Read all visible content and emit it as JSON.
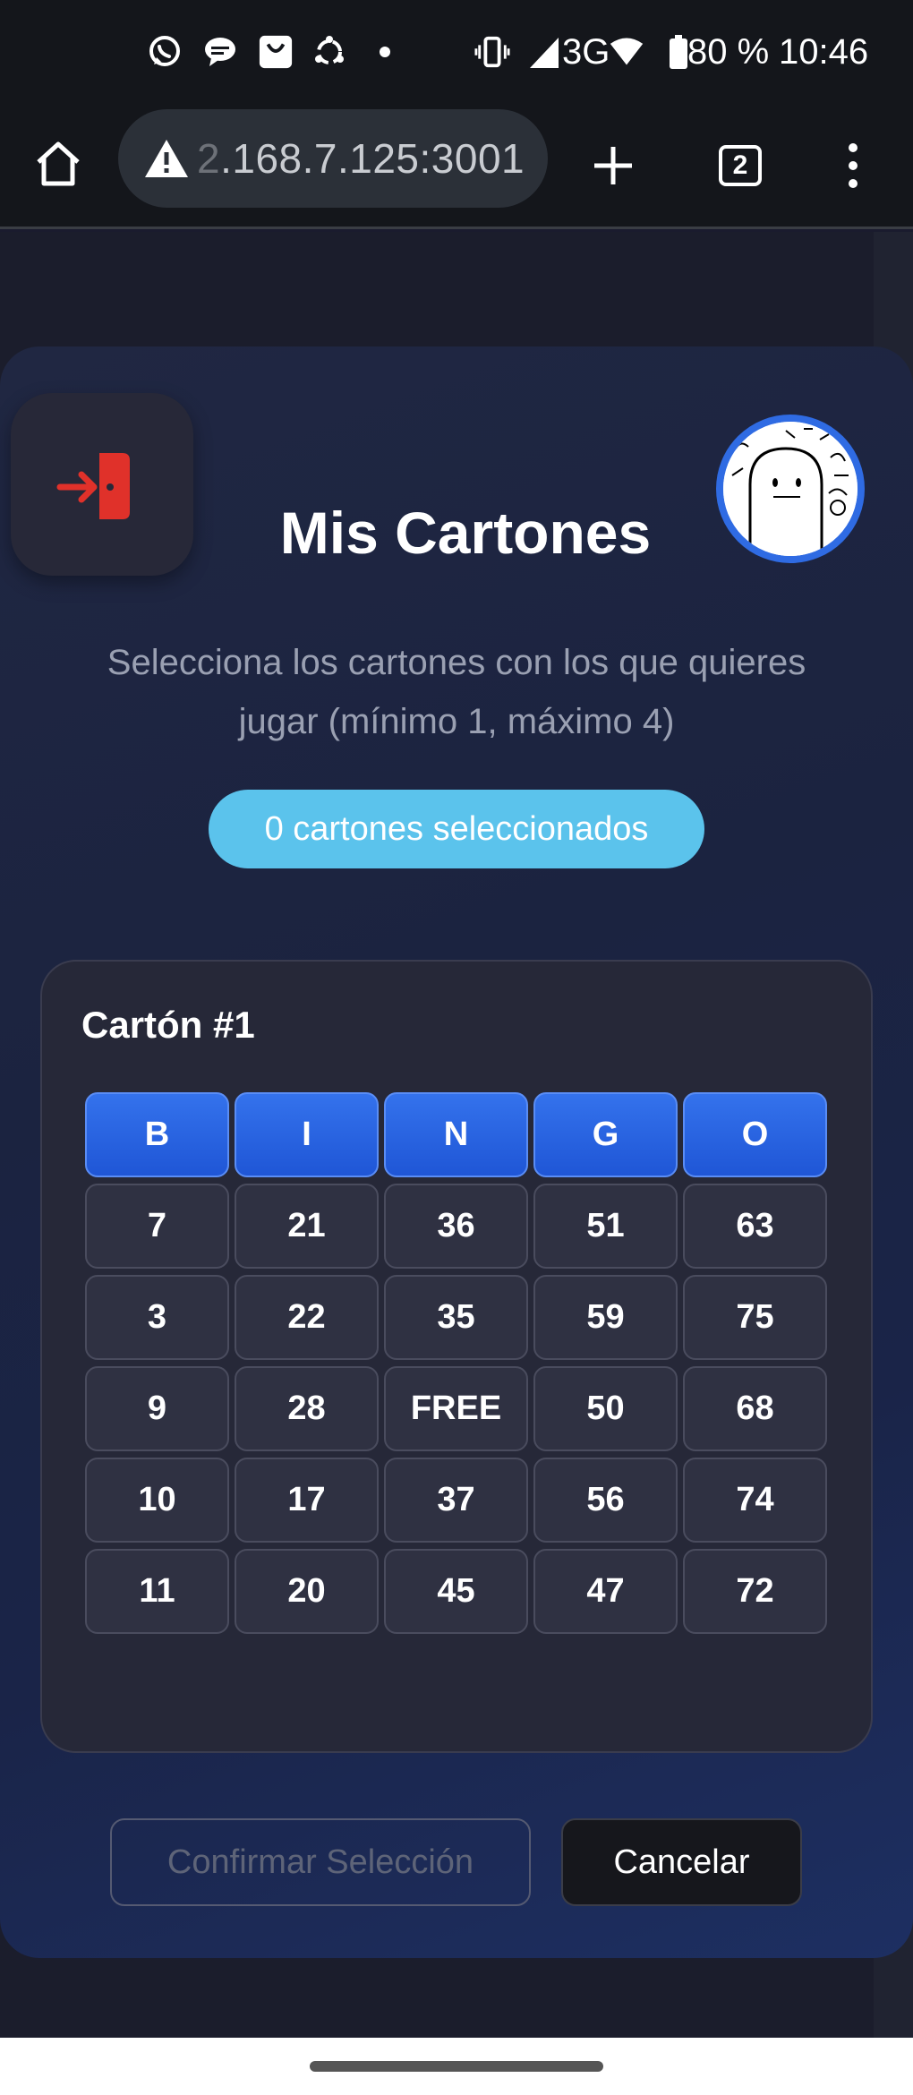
{
  "status_bar": {
    "network": "3G",
    "battery": "80 %",
    "time": "10:46"
  },
  "browser": {
    "url_faded": "2",
    "url": ".168.7.125:3001",
    "tabs_count": "2"
  },
  "modal": {
    "title": "Mis Cartones",
    "subtitle": "Selecciona los cartones con los que quieres jugar (mínimo 1, máximo 4)",
    "selected_count": "0 cartones seleccionados",
    "card": {
      "title": "Cartón #1",
      "headers": [
        "B",
        "I",
        "N",
        "G",
        "O"
      ],
      "rows": [
        [
          "7",
          "21",
          "36",
          "51",
          "63"
        ],
        [
          "3",
          "22",
          "35",
          "59",
          "75"
        ],
        [
          "9",
          "28",
          "FREE",
          "50",
          "68"
        ],
        [
          "10",
          "17",
          "37",
          "56",
          "74"
        ],
        [
          "11",
          "20",
          "45",
          "47",
          "72"
        ]
      ]
    },
    "confirm_label": "Confirmar Selección",
    "cancel_label": "Cancelar"
  },
  "colors": {
    "accent_blue": "#2f6be3",
    "badge_cyan": "#5bc3ec",
    "exit_red": "#e0312a"
  }
}
